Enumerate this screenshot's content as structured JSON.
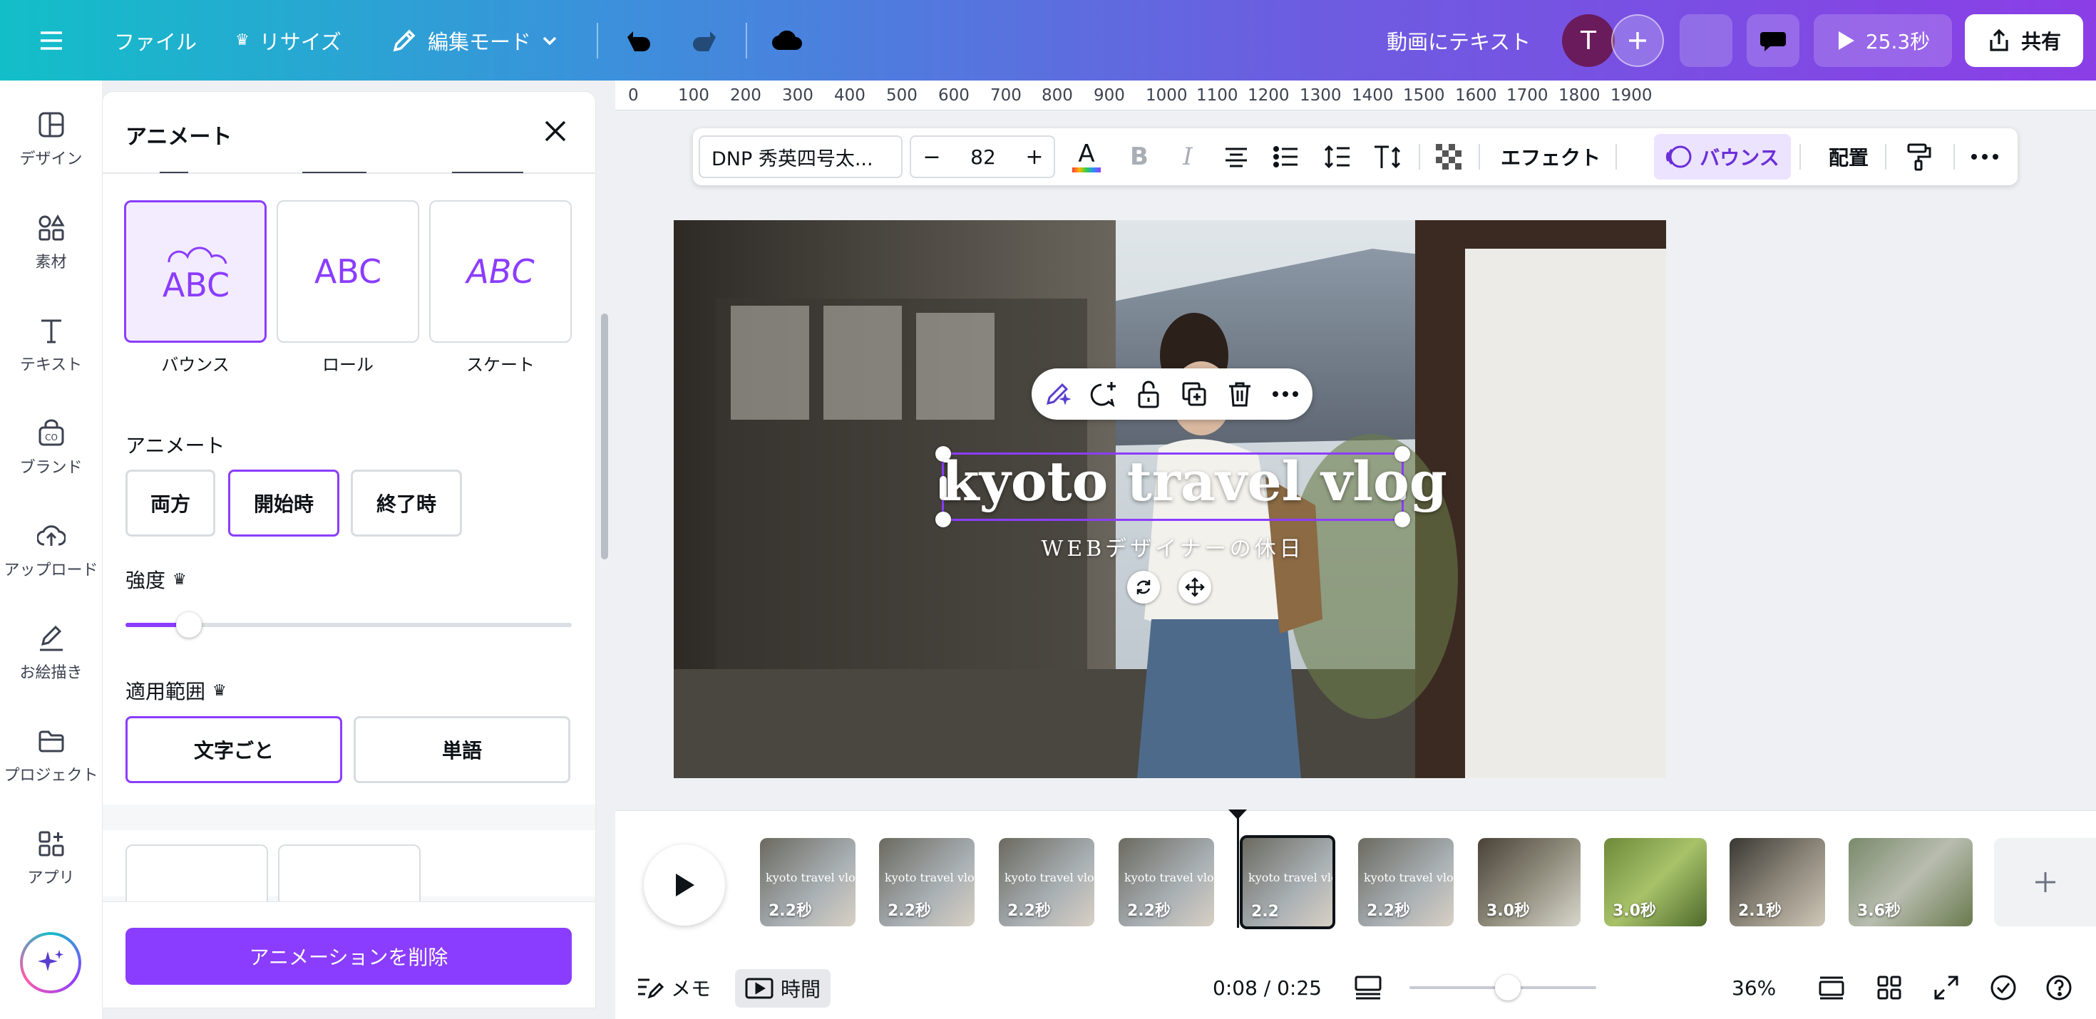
{
  "topbar": {
    "menu_icon": "hamburger-icon",
    "file": "ファイル",
    "resize": "リサイズ",
    "edit_mode": "編集モード",
    "doc_title": "動画にテキスト",
    "avatar_initial": "T",
    "play_duration": "25.3秒",
    "share": "共有"
  },
  "rail": {
    "items": [
      {
        "label": "デザイン",
        "icon": "design-icon"
      },
      {
        "label": "素材",
        "icon": "elements-icon"
      },
      {
        "label": "テキスト",
        "icon": "text-icon"
      },
      {
        "label": "ブランド",
        "icon": "brand-icon"
      },
      {
        "label": "アップロード",
        "icon": "upload-icon"
      },
      {
        "label": "お絵描き",
        "icon": "draw-icon"
      },
      {
        "label": "プロジェクト",
        "icon": "folder-icon"
      },
      {
        "label": "アプリ",
        "icon": "apps-icon"
      }
    ]
  },
  "panel": {
    "title": "アニメート",
    "styles": [
      {
        "label": "バウンス",
        "preview": "ABC",
        "selected": true
      },
      {
        "label": "ロール",
        "preview": "ABC",
        "selected": false
      },
      {
        "label": "スケート",
        "preview": "ABC",
        "selected": false
      }
    ],
    "animate_label": "アニメート",
    "animate_options": [
      {
        "label": "両方",
        "selected": false
      },
      {
        "label": "開始時",
        "selected": true
      },
      {
        "label": "終了時",
        "selected": false
      }
    ],
    "strength_label": "強度",
    "strength_value": 0.12,
    "scope_label": "適用範囲",
    "scope_options": [
      {
        "label": "文字ごと",
        "selected": true
      },
      {
        "label": "単語",
        "selected": false
      }
    ],
    "remove_button": "アニメーションを削除"
  },
  "ruler": {
    "ticks": [
      "0",
      "100",
      "200",
      "300",
      "400",
      "500",
      "600",
      "700",
      "800",
      "900",
      "1000",
      "1100",
      "1200",
      "1300",
      "1400",
      "1500",
      "1600",
      "1700",
      "1800",
      "1900"
    ]
  },
  "format_bar": {
    "font": "DNP 秀英四号太...",
    "minus": "−",
    "size": "82",
    "plus": "+",
    "effect": "エフェクト",
    "bounce": "バウンス",
    "position": "配置"
  },
  "canvas": {
    "title": "kyoto travel vlog",
    "subtitle": "WEBデザイナーの休日"
  },
  "timeline": {
    "clips": [
      {
        "text": "kyoto travel vlog",
        "duration": "2.2秒"
      },
      {
        "text": "kyoto travel vlog",
        "duration": "2.2秒"
      },
      {
        "text": "kyoto travel vlog",
        "duration": "2.2秒"
      },
      {
        "text": "kyoto travel vlog",
        "duration": "2.2秒"
      },
      {
        "text": "kyoto travel vlog",
        "duration": "2.2"
      },
      {
        "text": "kyoto travel vlog",
        "duration": "2.2秒"
      },
      {
        "text": "",
        "duration": "3.0秒"
      },
      {
        "text": "",
        "duration": "3.0秒"
      },
      {
        "text": "",
        "duration": "2.1秒"
      },
      {
        "text": "",
        "duration": "3.6秒"
      }
    ]
  },
  "bottombar": {
    "notes": "メモ",
    "timing": "時間",
    "time": "0:08 / 0:25",
    "zoom_percent": "36%"
  },
  "colors": {
    "accent": "#8b3dff",
    "topbar_start": "#12bfc8",
    "topbar_end": "#8b3ee6"
  }
}
